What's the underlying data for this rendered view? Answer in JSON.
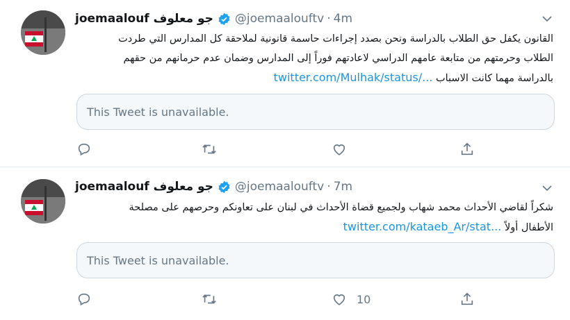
{
  "tweets": [
    {
      "name": "joemaalouf",
      "name_ar": "جو معلوف",
      "handle": "@joemaalouftv",
      "dot": "·",
      "time": "4m",
      "text_lines": [
        "القانون يكفل حق الطلاب بالدراسة ونحن بصدد إجراءات حاسمة قانونية لملاحقة كل المدارس التي طردت",
        "الطلاب وحرمتهم من متابعة عامهم الدراسي لاعادتهم فوراً إلى المدارس وضمان عدم حرمانهم من حقهم",
        "بالدراسة مهما كانت الاسباب"
      ],
      "link": "twitter.com/Mulhak/status/...",
      "quote": "This Tweet is unavailable.",
      "like_count": ""
    },
    {
      "name": "joemaalouf",
      "name_ar": "جو معلوف",
      "handle": "@joemaalouftv",
      "dot": "·",
      "time": "7m",
      "text_lines": [
        "شكراً لقاضي الأحداث محمد شهاب ولجميع قضاة الأحداث في لبنان على تعاونكم وحرصهم على مصلحة",
        "الأطفال أولاً"
      ],
      "link": "twitter.com/kataeb_Ar/stat...",
      "quote": "This Tweet is unavailable.",
      "like_count": "10"
    }
  ],
  "icons": {
    "verified": "verified-badge-icon",
    "caret": "chevron-down-icon",
    "reply": "reply-icon",
    "retweet": "retweet-icon",
    "like": "heart-icon",
    "share": "share-icon"
  },
  "colors": {
    "link": "#1b95e0",
    "verified": "#1da1f2",
    "secondary_text": "#657786",
    "border": "#ccd6dd"
  }
}
